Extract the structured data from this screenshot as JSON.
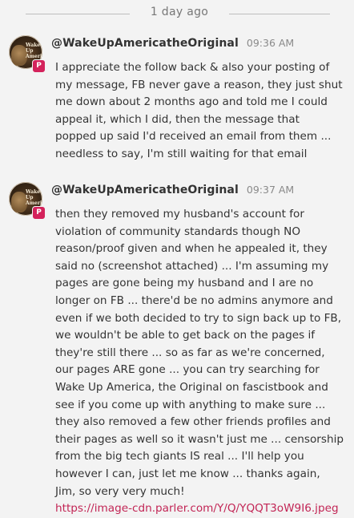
{
  "divider": {
    "label": "1 day ago"
  },
  "messages": [
    {
      "username": "@WakeUpAmericatheOriginal",
      "time": "09:36 AM",
      "avatar_text": "Wake Up America",
      "badge": "P",
      "text": "I appreciate the follow back & also your posting of my message, FB never gave a reason, they just shut me down about 2 months ago and told me I could appeal it, which I did, then the message that popped up said I'd received an email from them ... needless to say, I'm still waiting for that email"
    },
    {
      "username": "@WakeUpAmericatheOriginal",
      "time": "09:37 AM",
      "avatar_text": "Wake Up America",
      "badge": "P",
      "text": "then they removed my husband's account for violation of community standards though NO reason/proof  given and when he appealed it, they said no (screenshot attached) ... I'm assuming my pages are gone being my husband and I are no longer on FB ... there'd be no admins anymore and even if we both decided to try to sign back up to FB, we wouldn't be able to get back on the pages if they're still there ... so as far as we're concerned, our pages ARE gone ... you can try searching for Wake Up America, the Original on fascistbook and see if you come up with anything to make sure ... they also removed a few other friends profiles and their pages as well so it wasn't just me ... censorship from the big tech giants IS real ... I'll help you however I can, just let me know ... thanks again, Jim, so very very much!",
      "link": "https://image-cdn.parler.com/Y/Q/YQQT3oW9I6.jpeg"
    }
  ],
  "colors": {
    "accent": "#d4225b",
    "link": "#c22555",
    "background": "#f3f3f3"
  },
  "icons": {
    "badge": "parler-badge-icon"
  }
}
